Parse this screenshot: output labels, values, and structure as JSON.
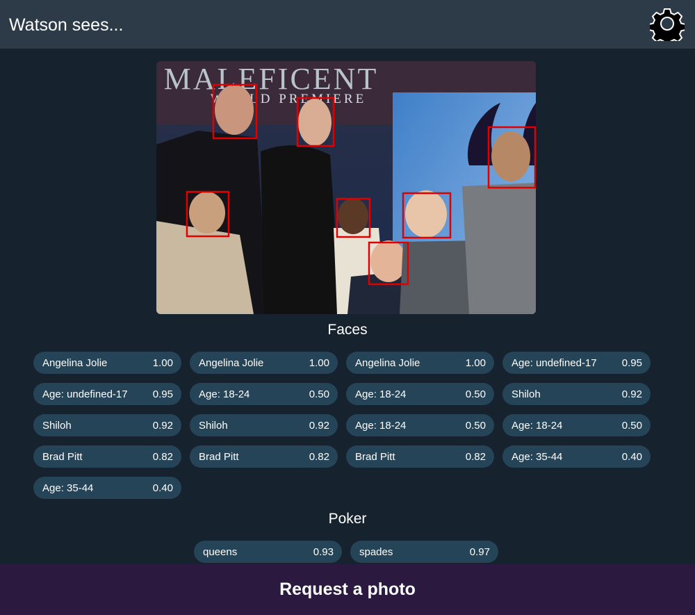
{
  "header": {
    "title": "Watson sees...",
    "settings_icon": "gear-icon"
  },
  "photo": {
    "banner_text_top": "MALEFICENT",
    "banner_text_bottom": "WORLD PREMIERE",
    "face_box_color": "#e00000"
  },
  "faces": {
    "heading": "Faces",
    "items": [
      {
        "label": "Angelina Jolie",
        "score": "1.00"
      },
      {
        "label": "Angelina Jolie",
        "score": "1.00"
      },
      {
        "label": "Angelina Jolie",
        "score": "1.00"
      },
      {
        "label": "Age: undefined-17",
        "score": "0.95"
      },
      {
        "label": "Age: undefined-17",
        "score": "0.95"
      },
      {
        "label": "Age: 18-24",
        "score": "0.50"
      },
      {
        "label": "Age: 18-24",
        "score": "0.50"
      },
      {
        "label": "Shiloh",
        "score": "0.92"
      },
      {
        "label": "Shiloh",
        "score": "0.92"
      },
      {
        "label": "Shiloh",
        "score": "0.92"
      },
      {
        "label": "Age: 18-24",
        "score": "0.50"
      },
      {
        "label": "Age: 18-24",
        "score": "0.50"
      },
      {
        "label": "Brad Pitt",
        "score": "0.82"
      },
      {
        "label": "Brad Pitt",
        "score": "0.82"
      },
      {
        "label": "Brad Pitt",
        "score": "0.82"
      },
      {
        "label": "Age: 35-44",
        "score": "0.40"
      },
      {
        "label": "Age: 35-44",
        "score": "0.40"
      }
    ]
  },
  "poker": {
    "heading": "Poker",
    "items": [
      {
        "label": "queens",
        "score": "0.93"
      },
      {
        "label": "spades",
        "score": "0.97"
      }
    ]
  },
  "footer": {
    "request_label": "Request a photo"
  },
  "colors": {
    "background": "#17222f",
    "header": "#2d3b48",
    "pill": "#254457",
    "footer": "#2b1940"
  }
}
